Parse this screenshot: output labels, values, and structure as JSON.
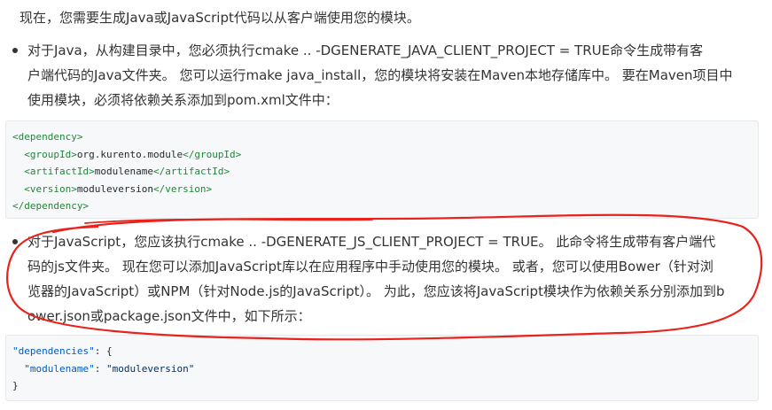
{
  "intro": "现在，您需要生成Java或JavaScript代码以从客户端使用您的模块。",
  "bullet_java": {
    "lines": [
      "对于Java，从构建目录中，您必须执行cmake .. -DGENERATE_JAVA_CLIENT_PROJECT = TRUE命令生成带有客",
      "户端代码的Java文件夹。 您可以运行make java_install，您的模块将安装在Maven本地存储库中。 要在Maven项目中",
      "使用模块，必须将依赖关系添加到pom.xml文件中："
    ]
  },
  "xml_code": {
    "open_dependency": "<dependency>",
    "group_open": "<groupId>",
    "group_val": "org.kurento.module",
    "group_close": "</groupId>",
    "artifact_open": "<artifactId>",
    "artifact_val": "modulename",
    "artifact_close": "</artifactId>",
    "version_open": "<version>",
    "version_val": "moduleversion",
    "version_close": "</version>",
    "close_dependency": "</dependency>"
  },
  "bullet_js": {
    "lines": [
      "对于JavaScript，您应该执行cmake .. -DGENERATE_JS_CLIENT_PROJECT = TRUE。 此命令将生成带有客户端代",
      "码的js文件夹。 现在您可以添加JavaScript库以在应用程序中手动使用您的模块。 或者，您可以使用Bower（针对浏",
      "览器的JavaScript）或NPM（针对Node.js的JavaScript）。 为此，您应该将JavaScript模块作为依赖关系分别添加到b",
      "ower.json或package.json文件中，如下所示："
    ]
  },
  "json_code": {
    "key_deps": "\"dependencies\"",
    "colon_brace": ": {",
    "key_mod": "\"modulename\"",
    "colon": ": ",
    "val_mod": "\"moduleversion\"",
    "close": "}"
  },
  "annotation_color": "#e8231c"
}
